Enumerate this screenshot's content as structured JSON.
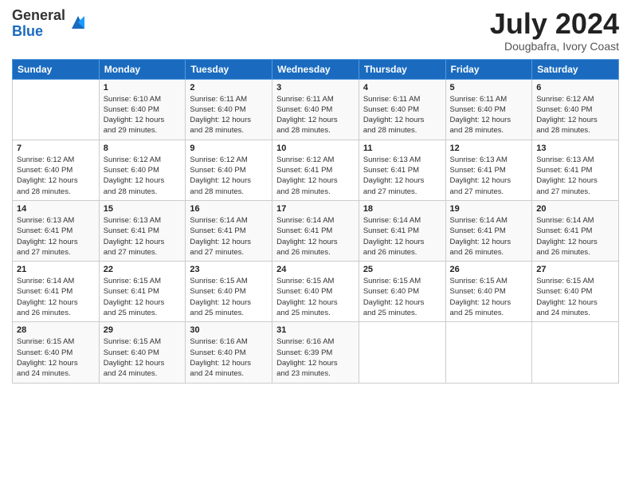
{
  "logo": {
    "general": "General",
    "blue": "Blue"
  },
  "title": "July 2024",
  "subtitle": "Dougbafra, Ivory Coast",
  "days_of_week": [
    "Sunday",
    "Monday",
    "Tuesday",
    "Wednesday",
    "Thursday",
    "Friday",
    "Saturday"
  ],
  "weeks": [
    [
      {
        "day": "",
        "info": ""
      },
      {
        "day": "1",
        "info": "Sunrise: 6:10 AM\nSunset: 6:40 PM\nDaylight: 12 hours\nand 29 minutes."
      },
      {
        "day": "2",
        "info": "Sunrise: 6:11 AM\nSunset: 6:40 PM\nDaylight: 12 hours\nand 28 minutes."
      },
      {
        "day": "3",
        "info": "Sunrise: 6:11 AM\nSunset: 6:40 PM\nDaylight: 12 hours\nand 28 minutes."
      },
      {
        "day": "4",
        "info": "Sunrise: 6:11 AM\nSunset: 6:40 PM\nDaylight: 12 hours\nand 28 minutes."
      },
      {
        "day": "5",
        "info": "Sunrise: 6:11 AM\nSunset: 6:40 PM\nDaylight: 12 hours\nand 28 minutes."
      },
      {
        "day": "6",
        "info": "Sunrise: 6:12 AM\nSunset: 6:40 PM\nDaylight: 12 hours\nand 28 minutes."
      }
    ],
    [
      {
        "day": "7",
        "info": ""
      },
      {
        "day": "8",
        "info": "Sunrise: 6:12 AM\nSunset: 6:40 PM\nDaylight: 12 hours\nand 28 minutes."
      },
      {
        "day": "9",
        "info": "Sunrise: 6:12 AM\nSunset: 6:40 PM\nDaylight: 12 hours\nand 28 minutes."
      },
      {
        "day": "10",
        "info": "Sunrise: 6:12 AM\nSunset: 6:41 PM\nDaylight: 12 hours\nand 28 minutes."
      },
      {
        "day": "11",
        "info": "Sunrise: 6:13 AM\nSunset: 6:41 PM\nDaylight: 12 hours\nand 27 minutes."
      },
      {
        "day": "12",
        "info": "Sunrise: 6:13 AM\nSunset: 6:41 PM\nDaylight: 12 hours\nand 27 minutes."
      },
      {
        "day": "13",
        "info": "Sunrise: 6:13 AM\nSunset: 6:41 PM\nDaylight: 12 hours\nand 27 minutes."
      }
    ],
    [
      {
        "day": "14",
        "info": ""
      },
      {
        "day": "15",
        "info": "Sunrise: 6:13 AM\nSunset: 6:41 PM\nDaylight: 12 hours\nand 27 minutes."
      },
      {
        "day": "16",
        "info": "Sunrise: 6:14 AM\nSunset: 6:41 PM\nDaylight: 12 hours\nand 27 minutes."
      },
      {
        "day": "17",
        "info": "Sunrise: 6:14 AM\nSunset: 6:41 PM\nDaylight: 12 hours\nand 26 minutes."
      },
      {
        "day": "18",
        "info": "Sunrise: 6:14 AM\nSunset: 6:41 PM\nDaylight: 12 hours\nand 26 minutes."
      },
      {
        "day": "19",
        "info": "Sunrise: 6:14 AM\nSunset: 6:41 PM\nDaylight: 12 hours\nand 26 minutes."
      },
      {
        "day": "20",
        "info": "Sunrise: 6:14 AM\nSunset: 6:41 PM\nDaylight: 12 hours\nand 26 minutes."
      }
    ],
    [
      {
        "day": "21",
        "info": ""
      },
      {
        "day": "22",
        "info": "Sunrise: 6:15 AM\nSunset: 6:41 PM\nDaylight: 12 hours\nand 25 minutes."
      },
      {
        "day": "23",
        "info": "Sunrise: 6:15 AM\nSunset: 6:40 PM\nDaylight: 12 hours\nand 25 minutes."
      },
      {
        "day": "24",
        "info": "Sunrise: 6:15 AM\nSunset: 6:40 PM\nDaylight: 12 hours\nand 25 minutes."
      },
      {
        "day": "25",
        "info": "Sunrise: 6:15 AM\nSunset: 6:40 PM\nDaylight: 12 hours\nand 25 minutes."
      },
      {
        "day": "26",
        "info": "Sunrise: 6:15 AM\nSunset: 6:40 PM\nDaylight: 12 hours\nand 25 minutes."
      },
      {
        "day": "27",
        "info": "Sunrise: 6:15 AM\nSunset: 6:40 PM\nDaylight: 12 hours\nand 24 minutes."
      }
    ],
    [
      {
        "day": "28",
        "info": "Sunrise: 6:15 AM\nSunset: 6:40 PM\nDaylight: 12 hours\nand 24 minutes."
      },
      {
        "day": "29",
        "info": "Sunrise: 6:15 AM\nSunset: 6:40 PM\nDaylight: 12 hours\nand 24 minutes."
      },
      {
        "day": "30",
        "info": "Sunrise: 6:16 AM\nSunset: 6:40 PM\nDaylight: 12 hours\nand 24 minutes."
      },
      {
        "day": "31",
        "info": "Sunrise: 6:16 AM\nSunset: 6:39 PM\nDaylight: 12 hours\nand 23 minutes."
      },
      {
        "day": "",
        "info": ""
      },
      {
        "day": "",
        "info": ""
      },
      {
        "day": "",
        "info": ""
      }
    ]
  ],
  "week1_day7_dayinfo": "Sunrise: 6:12 AM\nSunset: 6:40 PM\nDaylight: 12 hours\nand 28 minutes.",
  "week2_day14_dayinfo": "Sunrise: 6:13 AM\nSunset: 6:41 PM\nDaylight: 12 hours\nand 27 minutes.",
  "week3_day21_dayinfo": "Sunrise: 6:14 AM\nSunset: 6:41 PM\nDaylight: 12 hours\nand 26 minutes."
}
